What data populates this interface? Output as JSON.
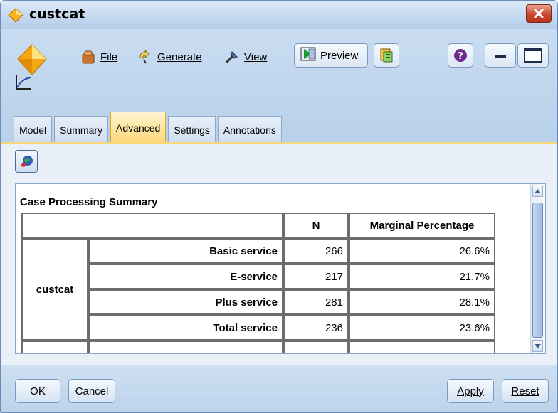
{
  "window": {
    "title": "custcat"
  },
  "toolbar": {
    "file_label": "File",
    "generate_label": "Generate",
    "view_label": "View",
    "preview_label": "Preview"
  },
  "tabs": [
    {
      "label": "Model"
    },
    {
      "label": "Summary"
    },
    {
      "label": "Advanced",
      "active": true
    },
    {
      "label": "Settings"
    },
    {
      "label": "Annotations"
    }
  ],
  "table": {
    "title": "Case Processing Summary",
    "headers": [
      "",
      "N",
      "Marginal Percentage"
    ],
    "group_label": "custcat",
    "rows": [
      {
        "label": "Basic service",
        "n": "266",
        "pct": "26.6%"
      },
      {
        "label": "E-service",
        "n": "217",
        "pct": "21.7%"
      },
      {
        "label": "Plus service",
        "n": "281",
        "pct": "28.1%"
      },
      {
        "label": "Total service",
        "n": "236",
        "pct": "23.6%"
      }
    ]
  },
  "buttons": {
    "ok": "OK",
    "cancel": "Cancel",
    "apply": "Apply",
    "reset": "Reset"
  },
  "colors": {
    "active_tab": "#fcd77a",
    "window_bg": "#b9d1ea",
    "close": "#c8472c"
  }
}
